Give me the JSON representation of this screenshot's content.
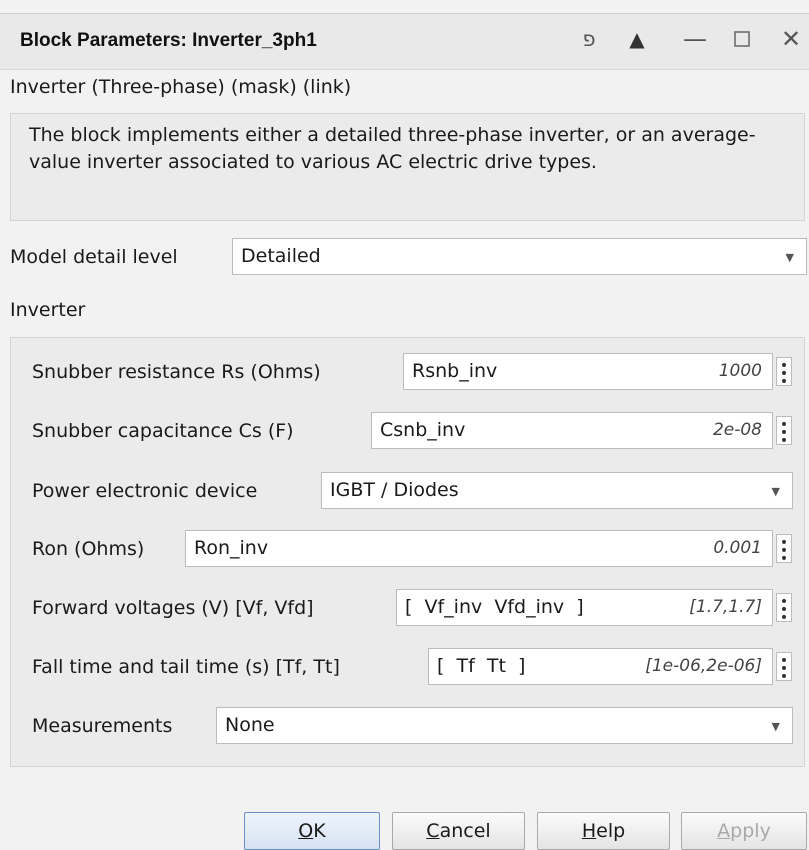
{
  "window": {
    "title": "Block Parameters: Inverter_3ph1",
    "controls": [
      "pin-icon",
      "triangle-up-icon",
      "minimize-icon",
      "maximize-icon",
      "close-icon"
    ]
  },
  "mask": {
    "title": "Inverter (Three-phase) (mask) (link)",
    "description": "The block implements either a detailed three-phase inverter, or an average-value inverter associated to various AC electric drive types."
  },
  "model_detail": {
    "label": "Model detail level",
    "value": "Detailed"
  },
  "section": {
    "title": "Inverter"
  },
  "params": {
    "rs": {
      "label": "Snubber resistance Rs (Ohms)",
      "value": "Rsnb_inv",
      "evaluated": "1000"
    },
    "cs": {
      "label": "Snubber capacitance Cs (F)",
      "value": "Csnb_inv",
      "evaluated": "2e-08"
    },
    "device": {
      "label": "Power electronic device",
      "value": "IGBT / Diodes"
    },
    "ron": {
      "label": "Ron (Ohms)",
      "value": "Ron_inv",
      "evaluated": "0.001"
    },
    "vf": {
      "label": "Forward voltages (V) [Vf, Vfd]",
      "value": "[  Vf_inv  Vfd_inv  ]",
      "evaluated": "[1.7,1.7]"
    },
    "tf": {
      "label": "Fall time and tail time (s) [Tf, Tt]",
      "value": "[  Tf  Tt  ]",
      "evaluated": "[1e-06,2e-06]"
    },
    "meas": {
      "label": "Measurements",
      "value": "None"
    }
  },
  "buttons": {
    "ok": {
      "mnemonic": "O",
      "rest": "K"
    },
    "cancel": {
      "mnemonic": "C",
      "rest": "ancel"
    },
    "help": {
      "mnemonic": "H",
      "rest": "elp"
    },
    "apply": {
      "mnemonic": "A",
      "rest": "pply"
    }
  }
}
